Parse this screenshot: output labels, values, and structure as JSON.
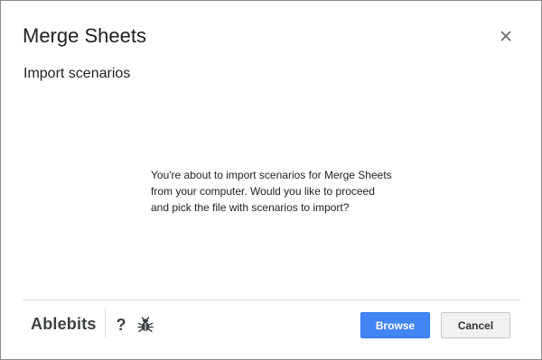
{
  "dialog": {
    "title": "Merge Sheets",
    "subtitle": "Import scenarios",
    "close_icon": "close-icon"
  },
  "message": {
    "lines": [
      "You're about to import scenarios for Merge Sheets",
      "from your computer. Would you like to proceed",
      "and pick the file with scenarios to import?"
    ]
  },
  "footer": {
    "brand": "Ablebits",
    "help_label": "?",
    "bug_icon": "bug-icon",
    "browse_label": "Browse",
    "cancel_label": "Cancel"
  },
  "colors": {
    "primary_button": "#4285f4",
    "secondary_button": "#f1f1f1",
    "text": "#202124"
  }
}
